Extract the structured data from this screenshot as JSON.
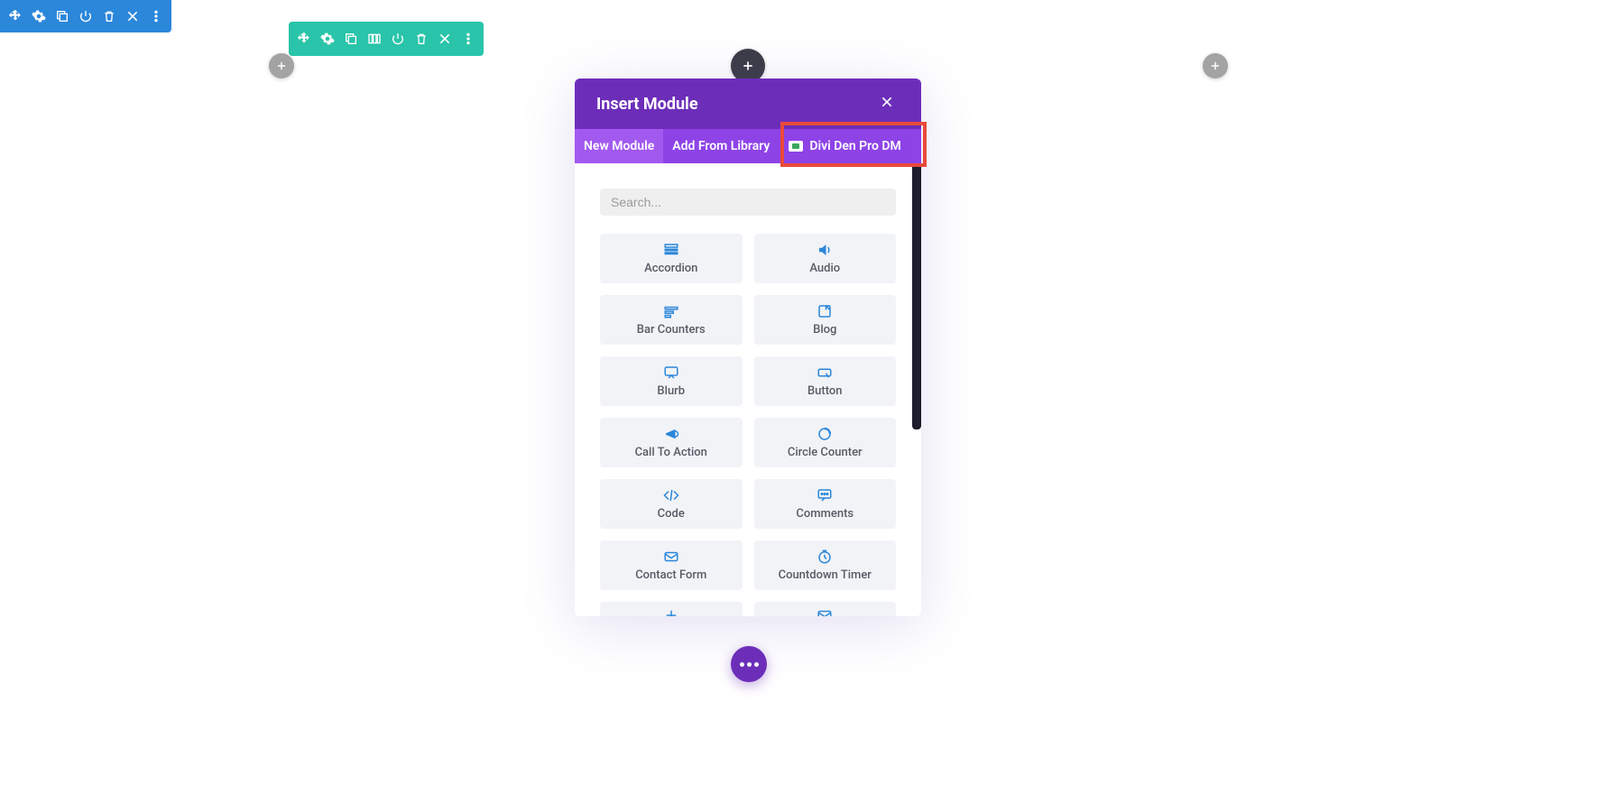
{
  "modal": {
    "title": "Insert Module",
    "tabs": [
      {
        "label": "New Module",
        "active": true
      },
      {
        "label": "Add From Library",
        "active": false
      },
      {
        "label": "Divi Den Pro DM",
        "active": false,
        "hasIcon": true,
        "highlighted": true
      }
    ],
    "search": {
      "placeholder": "Search..."
    },
    "modules": [
      {
        "label": "Accordion",
        "icon": "accordion"
      },
      {
        "label": "Audio",
        "icon": "audio"
      },
      {
        "label": "Bar Counters",
        "icon": "barcounters"
      },
      {
        "label": "Blog",
        "icon": "blog"
      },
      {
        "label": "Blurb",
        "icon": "blurb"
      },
      {
        "label": "Button",
        "icon": "button"
      },
      {
        "label": "Call To Action",
        "icon": "cta"
      },
      {
        "label": "Circle Counter",
        "icon": "circlecounter"
      },
      {
        "label": "Code",
        "icon": "code"
      },
      {
        "label": "Comments",
        "icon": "comments"
      },
      {
        "label": "Contact Form",
        "icon": "contactform"
      },
      {
        "label": "Countdown Timer",
        "icon": "countdown"
      }
    ]
  },
  "colors": {
    "section": "#2b87da",
    "row": "#29c4a9",
    "accent": "#6c2eb9",
    "tabBar": "#8e43e7",
    "highlight": "#e94a3c"
  }
}
